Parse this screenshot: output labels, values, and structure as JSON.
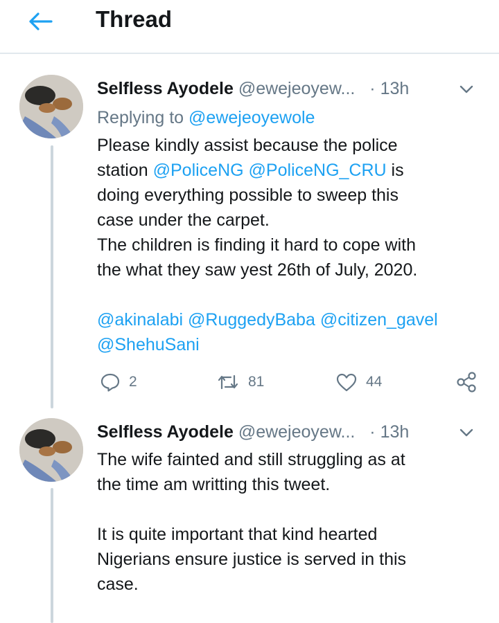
{
  "header": {
    "title": "Thread",
    "back_icon": "arrow-left-icon",
    "accent": "#1da1f2"
  },
  "tweets": [
    {
      "author_name": "Selfless Ayodele",
      "handle": "@ewejeoyew...",
      "separator": "·",
      "time": "13h",
      "replying_prefix": "Replying to",
      "replying_handle": "@ewejeoyewole",
      "text": {
        "l1": "Please kindly assist because the police",
        "l2_pre": "station ",
        "l2_m1": "@PoliceNG",
        "l2_m2": "@PoliceNG_CRU",
        "l2_post": " is",
        "l3": "doing everything possible to sweep this",
        "l4": "case under the carpet.",
        "l5": "The children is finding it hard to cope with",
        "l6": "the what they saw yest 26th of July, 2020.",
        "m_akinalabi": "@akinalabi",
        "m_ruggedy": "@RuggedyBaba",
        "m_citizen": "@citizen_gavel",
        "m_shehu": "@ShehuSani"
      },
      "actions": {
        "replies": "2",
        "retweets": "81",
        "likes": "44"
      }
    },
    {
      "author_name": "Selfless Ayodele",
      "handle": "@ewejeoyew...",
      "separator": "·",
      "time": "13h",
      "text": {
        "l1": "The wife fainted and still struggling as at",
        "l2": "the time am writting this tweet.",
        "l3": "It is quite important that kind hearted",
        "l4": "Nigerians ensure justice is served in this",
        "l5": "case."
      }
    }
  ]
}
